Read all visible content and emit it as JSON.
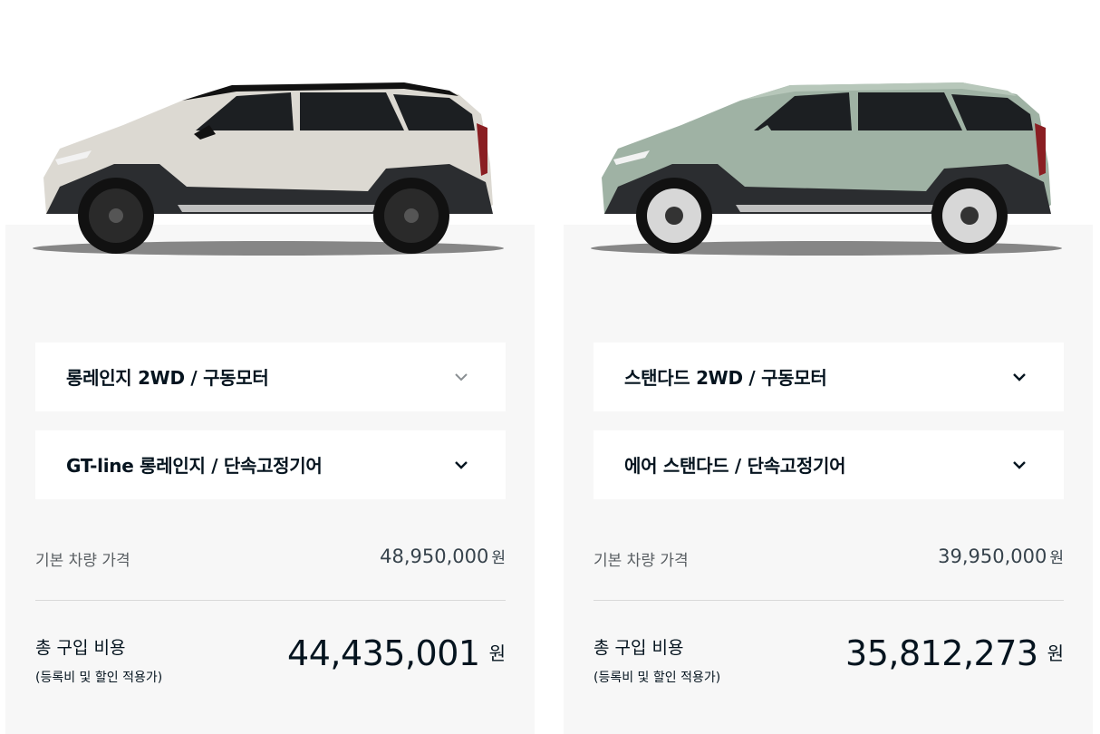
{
  "cards": [
    {
      "image": {
        "alt_name": "ev3-white-car",
        "body_color": "#dcd9d2",
        "roof_color": "#111111"
      },
      "trim_select": "롱레인지 2WD / 구동모터",
      "option_select": "GT-line 롱레인지 / 단속고정기어",
      "base_price_label": "기본 차량 가격",
      "base_price": "48,950,000",
      "base_price_unit": "원",
      "total_label": "총 구입 비용",
      "total_sub": "(등록비 및 할인 적용가)",
      "total_price": "44,435,001",
      "total_unit": "원"
    },
    {
      "image": {
        "alt_name": "ev3-green-car",
        "body_color": "#9fb2a4",
        "roof_color": "#111111"
      },
      "trim_select": "스탠다드 2WD / 구동모터",
      "option_select": "에어 스탠다드 / 단속고정기어",
      "base_price_label": "기본 차량 가격",
      "base_price": "39,950,000",
      "base_price_unit": "원",
      "total_label": "총 구입 비용",
      "total_sub": "(등록비 및 할인 적용가)",
      "total_price": "35,812,273",
      "total_unit": "원"
    }
  ],
  "icons": {
    "dropdown": "chevron-down-icon"
  },
  "colors": {
    "panel_bg": "#f7f7f7",
    "text_primary": "#05141f",
    "text_secondary": "#5a5f63",
    "divider": "#d9d9d9"
  }
}
